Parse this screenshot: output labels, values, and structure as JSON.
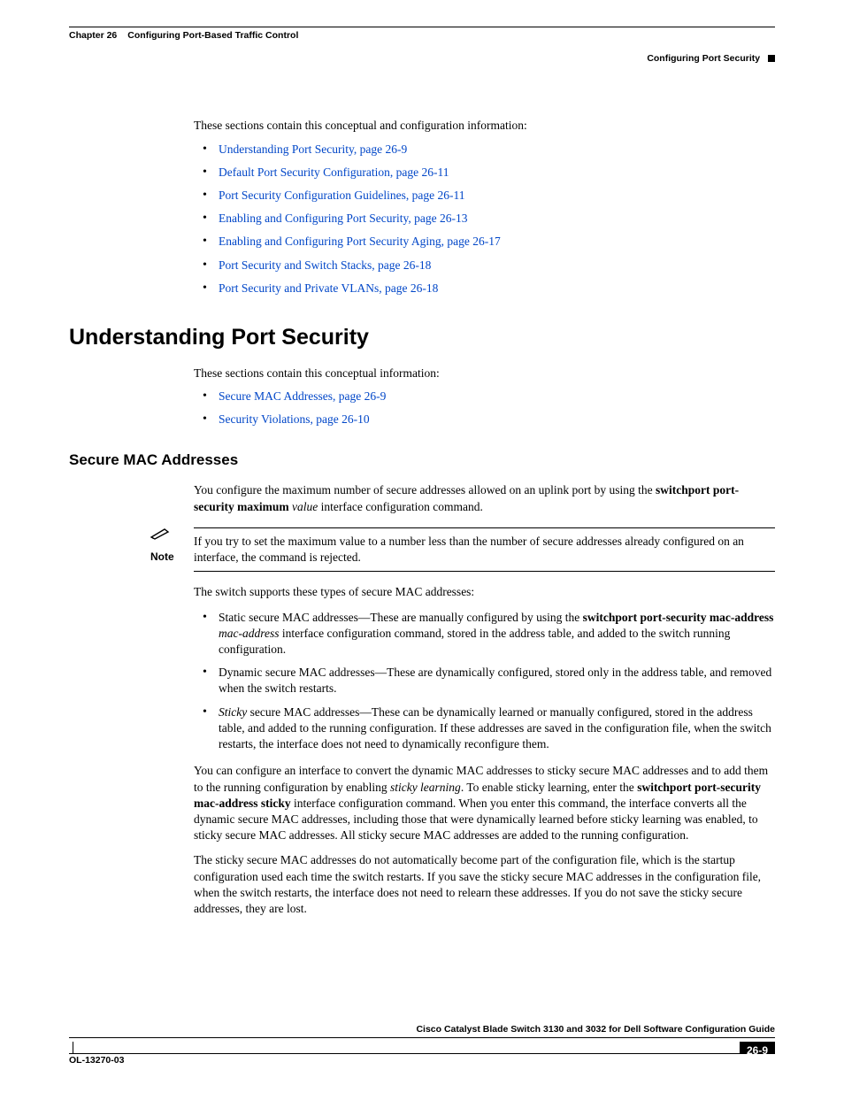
{
  "header": {
    "chapter": "Chapter 26",
    "chapter_title": "Configuring Port-Based Traffic Control",
    "section_right": "Configuring Port Security"
  },
  "intro1": "These sections contain this conceptual and configuration information:",
  "top_links": [
    "Understanding Port Security, page 26-9",
    "Default Port Security Configuration, page 26-11",
    "Port Security Configuration Guidelines, page 26-11",
    "Enabling and Configuring Port Security, page 26-13",
    "Enabling and Configuring Port Security Aging, page 26-17",
    "Port Security and Switch Stacks, page 26-18",
    "Port Security and Private VLANs, page 26-18"
  ],
  "h1": "Understanding Port Security",
  "intro2": "These sections contain this conceptual information:",
  "sub_links": [
    "Secure MAC Addresses, page 26-9",
    "Security Violations, page 26-10"
  ],
  "h2": "Secure MAC Addresses",
  "para_config": {
    "pre": "You configure the maximum number of secure addresses allowed on an uplink port by using the ",
    "cmd": "switchport port-security maximum",
    "arg": " value",
    "post": " interface configuration command."
  },
  "note": {
    "label": "Note",
    "body": "If you try to set the maximum value to a number less than the number of secure addresses already configured on an interface, the command is rejected."
  },
  "para_types": "The switch supports these types of secure MAC addresses:",
  "mac_list": {
    "static": {
      "pre": "Static secure MAC addresses—These are manually configured by using the ",
      "cmd": "switchport port-security mac-address",
      "arg": " mac-address",
      "post": " interface configuration command, stored in the address table, and added to the switch running configuration."
    },
    "dynamic": "Dynamic secure MAC addresses—These are dynamically configured, stored only in the address table, and removed when the switch restarts.",
    "sticky": {
      "em": "Sticky",
      "post": " secure MAC addresses—These can be dynamically learned or manually configured, stored in the address table, and added to the running configuration. If these addresses are saved in the configuration file, when the switch restarts, the interface does not need to dynamically reconfigure them."
    }
  },
  "para_sticky_cfg": {
    "pre": "You can configure an interface to convert the dynamic MAC addresses to sticky secure MAC addresses and to add them to the running configuration by enabling ",
    "em": "sticky learning",
    "mid": ". To enable sticky learning, enter the ",
    "cmd": "switchport port-security mac-address sticky",
    "post": " interface configuration command. When you enter this command, the interface converts all the dynamic secure MAC addresses, including those that were dynamically learned before sticky learning was enabled, to sticky secure MAC addresses. All sticky secure MAC addresses are added to the running configuration."
  },
  "para_save": "The sticky secure MAC addresses do not automatically become part of the configuration file, which is the startup configuration used each time the switch restarts. If you save the sticky secure MAC addresses in the configuration file, when the switch restarts, the interface does not need to relearn these addresses. If you do not save the sticky secure addresses, they are lost.",
  "footer": {
    "guide": "Cisco Catalyst Blade Switch 3130 and 3032 for Dell Software Configuration Guide",
    "doc_id": "OL-13270-03",
    "page": "26-9"
  }
}
